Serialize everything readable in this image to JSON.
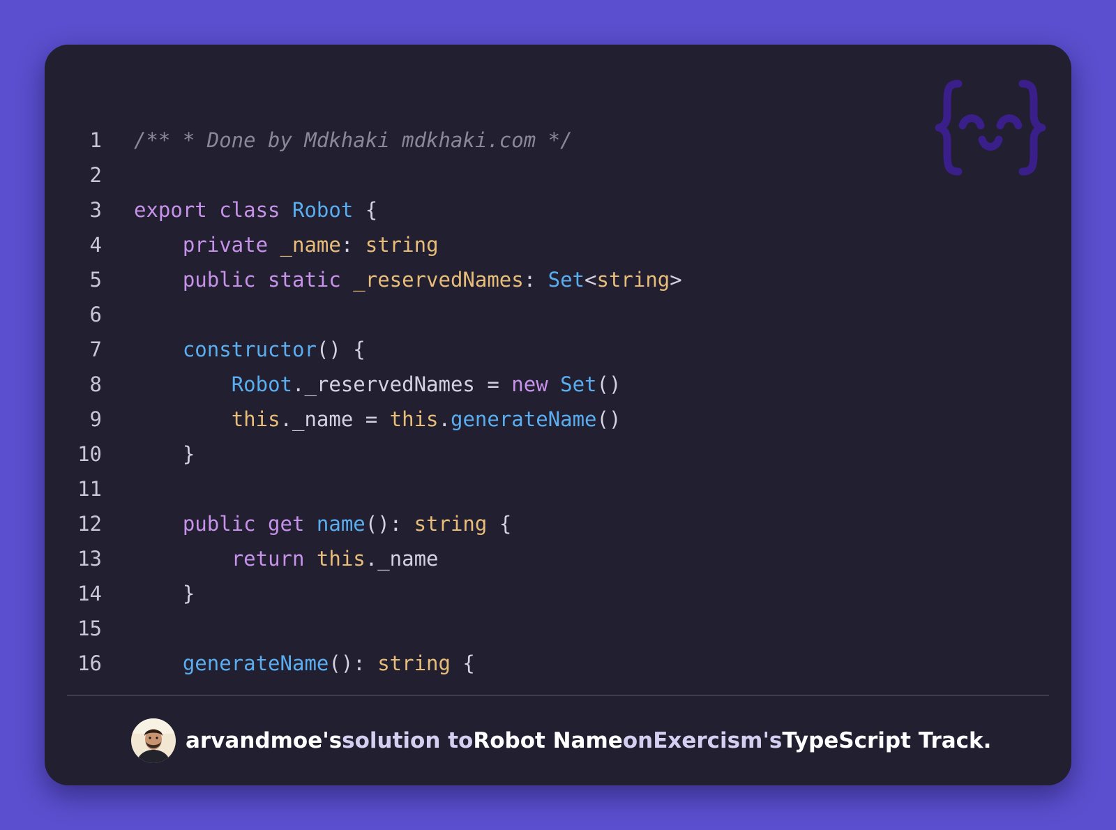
{
  "code": {
    "lines": [
      {
        "n": "1",
        "parts": [
          {
            "t": "/** * Done by Mdkhaki mdkhaki.com */",
            "c": "cmt"
          }
        ]
      },
      {
        "n": "2",
        "parts": []
      },
      {
        "n": "3",
        "parts": [
          {
            "t": "export class ",
            "c": "kw"
          },
          {
            "t": "Robot",
            "c": "fn"
          },
          {
            "t": " {",
            "c": "pn"
          }
        ]
      },
      {
        "n": "4",
        "parts": [
          {
            "t": "    ",
            "c": "pn"
          },
          {
            "t": "private ",
            "c": "kw"
          },
          {
            "t": "_name",
            "c": "ty"
          },
          {
            "t": ": ",
            "c": "pn"
          },
          {
            "t": "string",
            "c": "ty"
          }
        ]
      },
      {
        "n": "5",
        "parts": [
          {
            "t": "    ",
            "c": "pn"
          },
          {
            "t": "public static ",
            "c": "kw"
          },
          {
            "t": "_reservedNames",
            "c": "ty"
          },
          {
            "t": ": ",
            "c": "pn"
          },
          {
            "t": "Set",
            "c": "fn"
          },
          {
            "t": "<",
            "c": "pn"
          },
          {
            "t": "string",
            "c": "ty"
          },
          {
            "t": ">",
            "c": "pn"
          }
        ]
      },
      {
        "n": "6",
        "parts": []
      },
      {
        "n": "7",
        "parts": [
          {
            "t": "    ",
            "c": "pn"
          },
          {
            "t": "constructor",
            "c": "fn"
          },
          {
            "t": "() {",
            "c": "pn"
          }
        ]
      },
      {
        "n": "8",
        "parts": [
          {
            "t": "        ",
            "c": "pn"
          },
          {
            "t": "Robot",
            "c": "fn"
          },
          {
            "t": "._reservedNames = ",
            "c": "pn"
          },
          {
            "t": "new ",
            "c": "kw"
          },
          {
            "t": "Set",
            "c": "fn"
          },
          {
            "t": "()",
            "c": "pn"
          }
        ]
      },
      {
        "n": "9",
        "parts": [
          {
            "t": "        ",
            "c": "pn"
          },
          {
            "t": "this",
            "c": "ty"
          },
          {
            "t": "._name = ",
            "c": "pn"
          },
          {
            "t": "this",
            "c": "ty"
          },
          {
            "t": ".",
            "c": "pn"
          },
          {
            "t": "generateName",
            "c": "fn"
          },
          {
            "t": "()",
            "c": "pn"
          }
        ]
      },
      {
        "n": "10",
        "parts": [
          {
            "t": "    }",
            "c": "pn"
          }
        ]
      },
      {
        "n": "11",
        "parts": []
      },
      {
        "n": "12",
        "parts": [
          {
            "t": "    ",
            "c": "pn"
          },
          {
            "t": "public get ",
            "c": "kw"
          },
          {
            "t": "name",
            "c": "fn"
          },
          {
            "t": "(): ",
            "c": "pn"
          },
          {
            "t": "string",
            "c": "ty"
          },
          {
            "t": " {",
            "c": "pn"
          }
        ]
      },
      {
        "n": "13",
        "parts": [
          {
            "t": "        ",
            "c": "pn"
          },
          {
            "t": "return ",
            "c": "kw"
          },
          {
            "t": "this",
            "c": "ty"
          },
          {
            "t": "._name",
            "c": "pn"
          }
        ]
      },
      {
        "n": "14",
        "parts": [
          {
            "t": "    }",
            "c": "pn"
          }
        ]
      },
      {
        "n": "15",
        "parts": []
      },
      {
        "n": "16",
        "parts": [
          {
            "t": "    ",
            "c": "pn"
          },
          {
            "t": "generateName",
            "c": "fn"
          },
          {
            "t": "(): ",
            "c": "pn"
          },
          {
            "t": "string",
            "c": "ty"
          },
          {
            "t": " {",
            "c": "pn"
          }
        ]
      }
    ]
  },
  "logo": {
    "icon": "exercism-curly-face-icon",
    "color": "#3a1f8a"
  },
  "footer": {
    "author": "arvandmoe",
    "possessive1": "'s",
    "solution_text": " solution to ",
    "exercise": "Robot Name",
    "on_text": " on ",
    "site": "Exercism",
    "possessive2": "'s",
    "track": " TypeScript Track."
  },
  "colors": {
    "background": "#5b4fcf",
    "card": "#211f30",
    "keyword": "#c792ea",
    "type": "#e8bd7a",
    "function": "#5aaef0",
    "comment": "#8a8799"
  }
}
